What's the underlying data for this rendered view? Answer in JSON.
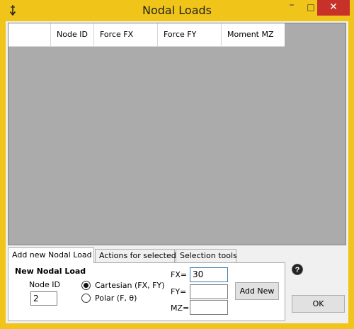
{
  "window": {
    "title": "Nodal Loads",
    "icon": "load-arrow-icon",
    "controls": {
      "minimize": "–",
      "maximize": "□",
      "close": "✕"
    },
    "accent_color": "#f0c419",
    "close_color": "#c7312a"
  },
  "grid": {
    "columns": [
      "",
      "Node ID",
      "Force FX",
      "Force FY",
      "Moment MZ"
    ],
    "rows": []
  },
  "tabs": [
    {
      "label": "Add new Nodal Load",
      "active": true
    },
    {
      "label": "Actions for selected",
      "active": false
    },
    {
      "label": "Selection tools",
      "active": false
    }
  ],
  "panel": {
    "group_title": "New Nodal Load",
    "node_id_label": "Node ID",
    "node_id_value": "2",
    "coord_options": [
      {
        "label": "Cartesian (FX, FY)",
        "checked": true
      },
      {
        "label": "Polar (F, θ)",
        "checked": false
      }
    ],
    "fields": {
      "fx_label": "FX=",
      "fx_value": "30",
      "fy_label": "FY=",
      "fy_value": "",
      "mz_label": "MZ=",
      "mz_value": ""
    },
    "add_button": "Add New"
  },
  "help": {
    "glyph": "?"
  },
  "ok_button": "OK"
}
